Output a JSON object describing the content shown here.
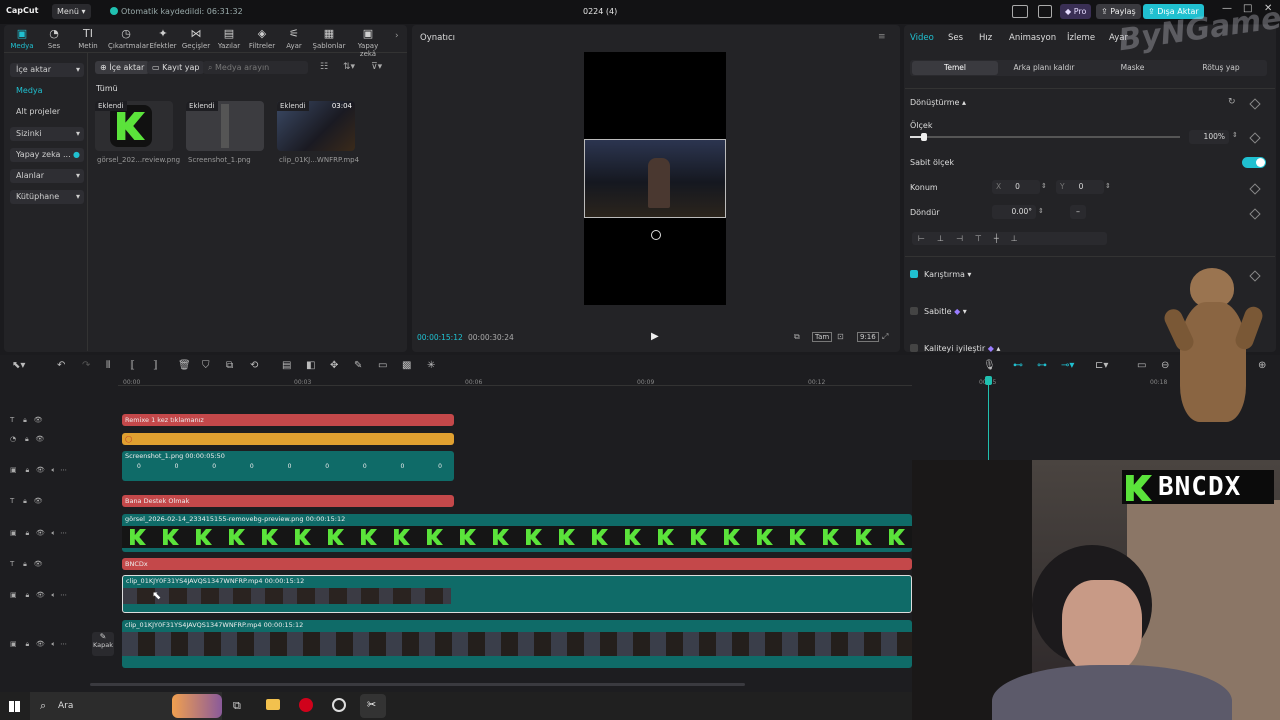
{
  "titlebar": {
    "logo": "CapCut",
    "menu_label": "Menü ▾",
    "autosave_text": "Otomatik kaydedildi: 06:31:32",
    "project_title": "0224 (4)",
    "pro_label": "Pro",
    "share_label": "Paylaş",
    "export_label": "Dışa Aktar"
  },
  "toolbar": {
    "items": [
      "Medya",
      "Ses",
      "Metin",
      "Çıkartmalar",
      "Efektler",
      "Geçişler",
      "Yazılar",
      "Filtreler",
      "Ayar",
      "Şablonlar",
      "Yapay zekâ"
    ]
  },
  "sidebar": {
    "items": [
      "İçe aktar",
      "Medya",
      "Alt projeler",
      "Sizinki",
      "Yapay zeka ...",
      "Alanlar",
      "Kütüphane"
    ]
  },
  "media": {
    "import_btn": "İçe aktar",
    "record_btn": "Kayıt yap",
    "search_placeholder": "Medya arayın",
    "filter_all": "Tümü",
    "items": [
      {
        "tag": "Eklendi",
        "name": "görsel_202...review.png",
        "duration": ""
      },
      {
        "tag": "Eklendi",
        "name": "Screenshot_1.png",
        "duration": ""
      },
      {
        "tag": "Eklendi",
        "name": "clip_01KJ...WNFRP.mp4",
        "duration": "03:04"
      }
    ]
  },
  "player": {
    "title": "Oynatıcı",
    "current_time": "00:00:15:12",
    "total_time": "00:00:30:24",
    "btn_full": "Tam",
    "btn_ratio": "9:16"
  },
  "inspector": {
    "tabs": [
      "Video",
      "Ses",
      "Hız",
      "Animasyon",
      "İzleme",
      "Ayar"
    ],
    "subtabs": [
      "Temel",
      "Arka planı kaldır",
      "Maske",
      "Rötuş yap"
    ],
    "section_transform": "Dönüştürme",
    "scale_label": "Ölçek",
    "scale_value": "100%",
    "scale_fraction": 0.05,
    "uniform_scale": "Sabit ölçek",
    "position_label": "Konum",
    "pos_x_label": "X",
    "pos_x": "0",
    "pos_y_label": "Y",
    "pos_y": "0",
    "rotate_label": "Döndür",
    "rotate_value": "0.00°",
    "blend_label": "Karıştırma",
    "stabilize_label": "Sabitle",
    "enhance_label": "Kaliteyi iyileştir"
  },
  "timeline": {
    "ruler": [
      "00:00",
      "00:03",
      "00:06",
      "00:09",
      "00:12",
      "00:15",
      "00:18"
    ],
    "tracks": [
      {
        "label": "Remixe 1 kez tıklamanız",
        "kind": "text"
      },
      {
        "label": "",
        "kind": "sticker"
      },
      {
        "label": "Screenshot_1.png   00:00:05:50",
        "kind": "image"
      },
      {
        "label": "Bana Destek Olmak",
        "kind": "text"
      },
      {
        "label": "görsel_2026-02-14_233415155-removebg-preview.png   00:00:15:12",
        "kind": "image"
      },
      {
        "label": "BNCDx",
        "kind": "text"
      },
      {
        "label": "clip_01KJY0F31YS4JAVQS1347WNFRP.mp4   00:00:15:12",
        "kind": "video"
      },
      {
        "label": "clip_01KJY0F31YS4JAVQS1347WNFRP.mp4   00:00:15:12",
        "kind": "video"
      }
    ],
    "cover_label": "Kapak",
    "screenshot_keyframes": [
      "0",
      "0",
      "0",
      "0",
      "0",
      "0",
      "0",
      "0",
      "0"
    ]
  },
  "taskbar": {
    "search_label": "Ara"
  },
  "overlay": {
    "channel_name": "BNCDX",
    "watermark": "ByNGame"
  },
  "colors": {
    "accent": "#20c0b0",
    "text_clip": "#c4484a",
    "sticker_clip": "#e0a030",
    "media_clip": "#0f6b68",
    "green_logo": "#5be33b"
  }
}
